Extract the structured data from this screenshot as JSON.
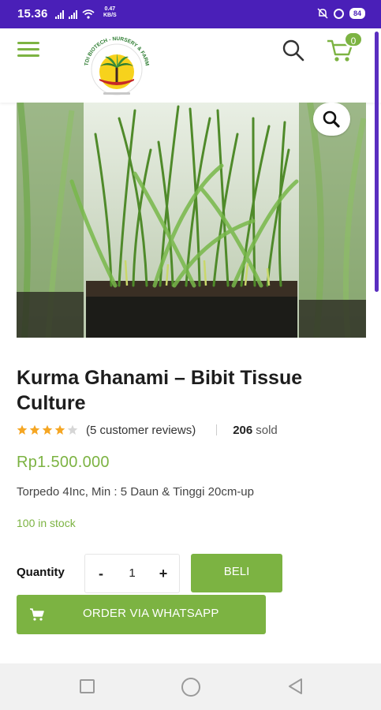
{
  "status_bar": {
    "time": "15.36",
    "net_speed_value": "0.47",
    "net_speed_unit": "KB/S",
    "battery": "84"
  },
  "header": {
    "logo_text": "TDI BIOTECH - NURSERY & FARM",
    "cart_count": "0"
  },
  "product": {
    "title": "Kurma Ghanami – Bibit Tissue Culture",
    "rating": 4,
    "rating_max": 5,
    "reviews_text": "(5 customer reviews)",
    "sold_count": "206",
    "sold_label": "sold",
    "price": "Rp1.500.000",
    "description": "Torpedo 4Inc, Min : 5 Daun & Tinggi 20cm-up",
    "stock": "100 in stock"
  },
  "purchase": {
    "quantity_label": "Quantity",
    "minus": "-",
    "plus": "+",
    "quantity_value": "1",
    "buy_label": "BELI",
    "whatsapp_label": "ORDER VIA WHATSAPP"
  },
  "colors": {
    "accent": "#7cb342",
    "status_bar": "#4a1fb8",
    "star": "#f5a623"
  },
  "icons": [
    "menu-icon",
    "search-icon",
    "cart-icon",
    "zoom-icon",
    "star-icon",
    "whatsapp-cart-icon",
    "nav-recents-icon",
    "nav-home-icon",
    "nav-back-icon"
  ]
}
